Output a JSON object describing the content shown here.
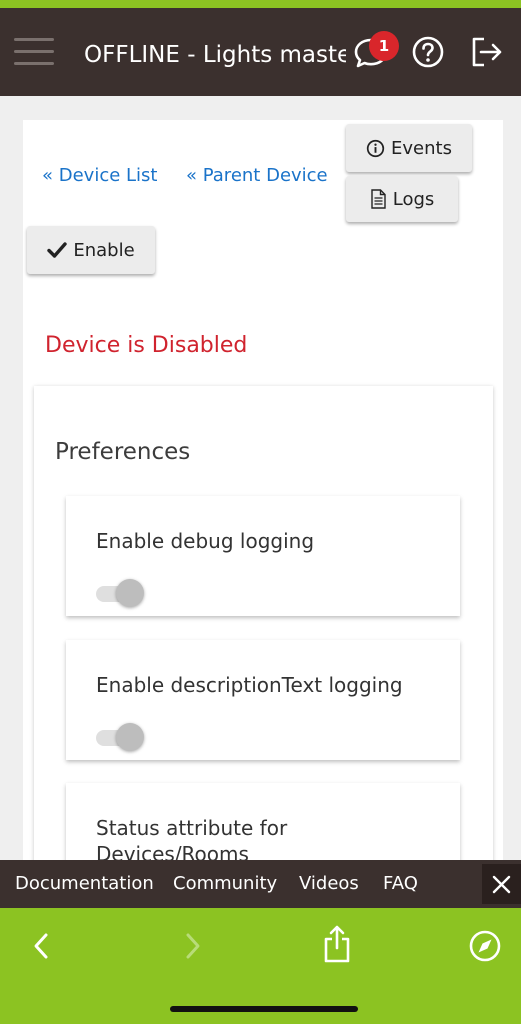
{
  "header": {
    "title": "OFFLINE - Lights maste",
    "notification_count": "1",
    "icons": [
      "menu-icon",
      "chat-bubble-icon",
      "help-icon",
      "logout-icon"
    ]
  },
  "nav": {
    "device_list_link": "« Device List",
    "parent_device_link": "« Parent Device",
    "events_button": "Events",
    "logs_button": "Logs",
    "enable_button": "Enable"
  },
  "status": {
    "disabled_message": "Device is Disabled"
  },
  "preferences": {
    "title": "Preferences",
    "items": [
      {
        "label": "Enable debug logging",
        "value": "on"
      },
      {
        "label": "Enable descriptionText logging",
        "value": "on"
      },
      {
        "label": "Status attribute for Devices/Rooms"
      }
    ]
  },
  "footer": {
    "links": [
      "Documentation",
      "Community",
      "Videos",
      "FAQ"
    ]
  },
  "browser": {
    "icons": [
      "back-arrow-icon",
      "forward-arrow-icon",
      "share-icon",
      "compass-icon"
    ]
  },
  "colors": {
    "header_bg": "#3b302e",
    "accent_green": "#8cc322",
    "link_blue": "#1a73c9",
    "error_red": "#d0232e",
    "badge_red": "#d9262b"
  }
}
